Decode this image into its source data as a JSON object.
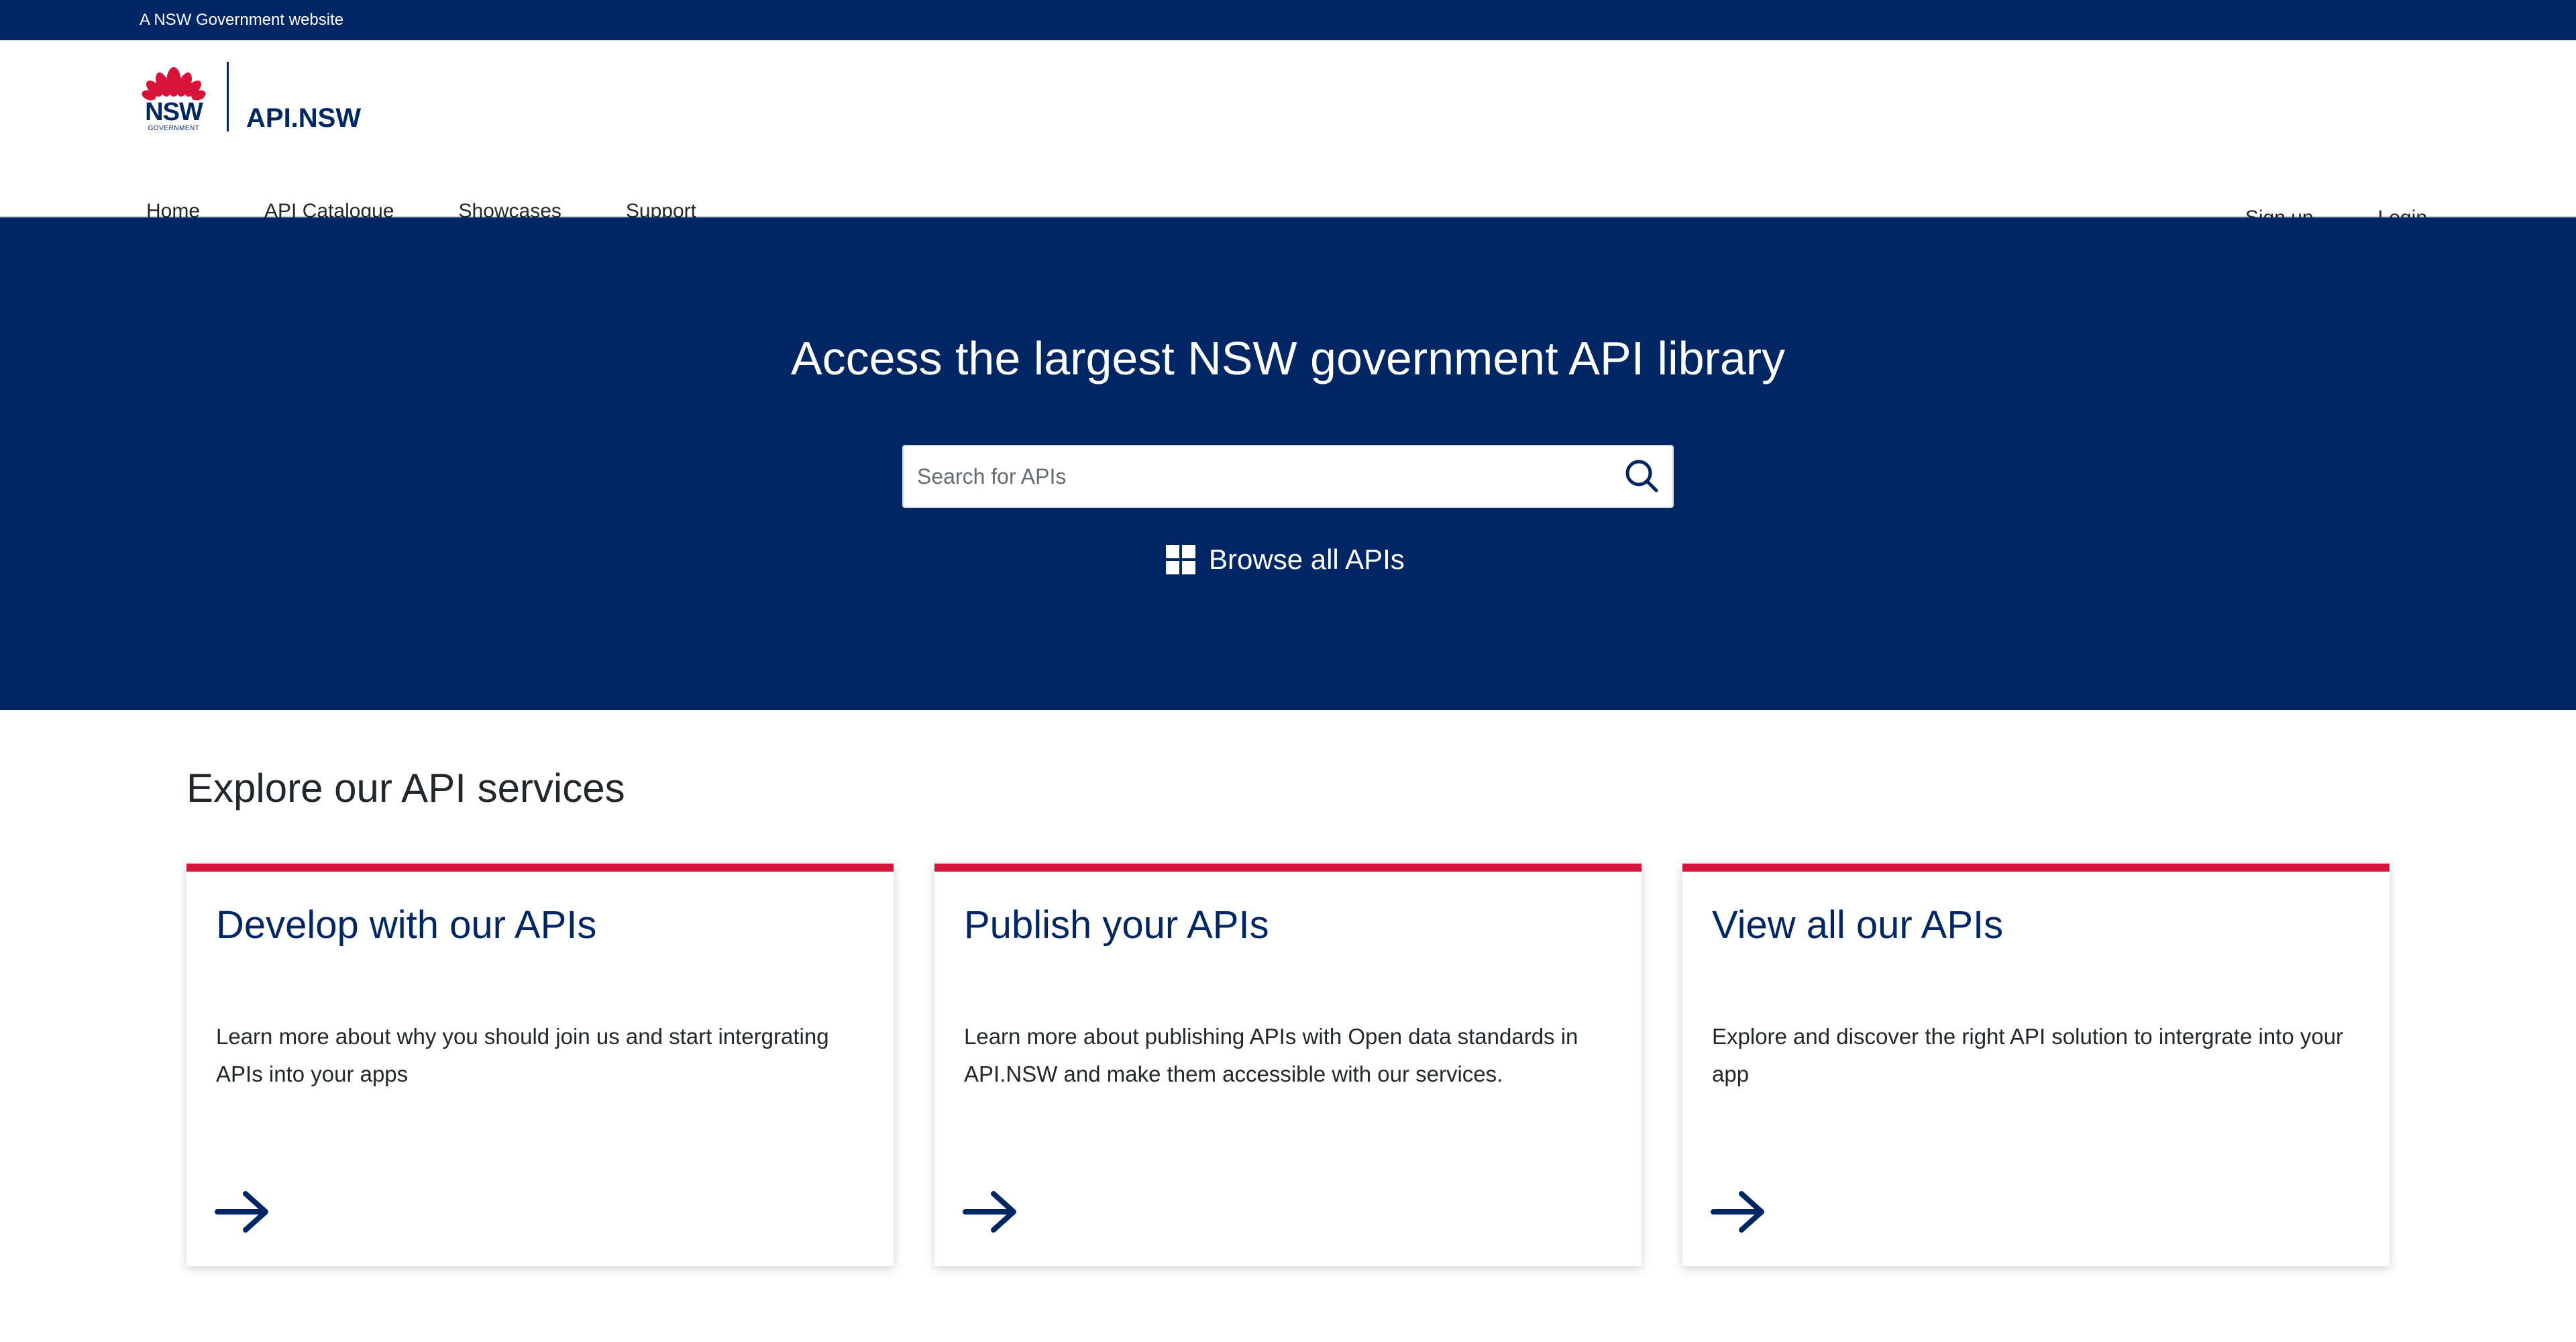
{
  "gov_bar": {
    "text": "A NSW Government website"
  },
  "brand": {
    "logo_text": "NSW",
    "logo_subtext": "GOVERNMENT",
    "name": "API.NSW"
  },
  "nav": {
    "items": [
      {
        "label": "Home",
        "active": true
      },
      {
        "label": "API Catalogue",
        "active": false
      },
      {
        "label": "Showcases",
        "active": false
      },
      {
        "label": "Support",
        "active": false
      }
    ]
  },
  "auth": {
    "signup": "Sign up",
    "login": "Login"
  },
  "hero": {
    "title": "Access the largest NSW government API library",
    "search_placeholder": "Search for APIs",
    "browse_label": "Browse all APIs"
  },
  "explore": {
    "title": "Explore our API services",
    "cards": [
      {
        "title": "Develop with our APIs",
        "description": "Learn more about why you should join us and start intergrating APIs into your apps"
      },
      {
        "title": "Publish your APIs",
        "description": "Learn more about publishing APIs with Open data standards in API.NSW and make them accessible with our services."
      },
      {
        "title": "View all our APIs",
        "description": "Explore and discover the right API solution to intergrate into your app"
      }
    ]
  },
  "colors": {
    "primary_navy": "#002664",
    "accent_red": "#d7153a",
    "text": "#22272b"
  },
  "icons": [
    "waratah-logo-icon",
    "search-icon",
    "grid-icon",
    "arrow-right-icon"
  ]
}
